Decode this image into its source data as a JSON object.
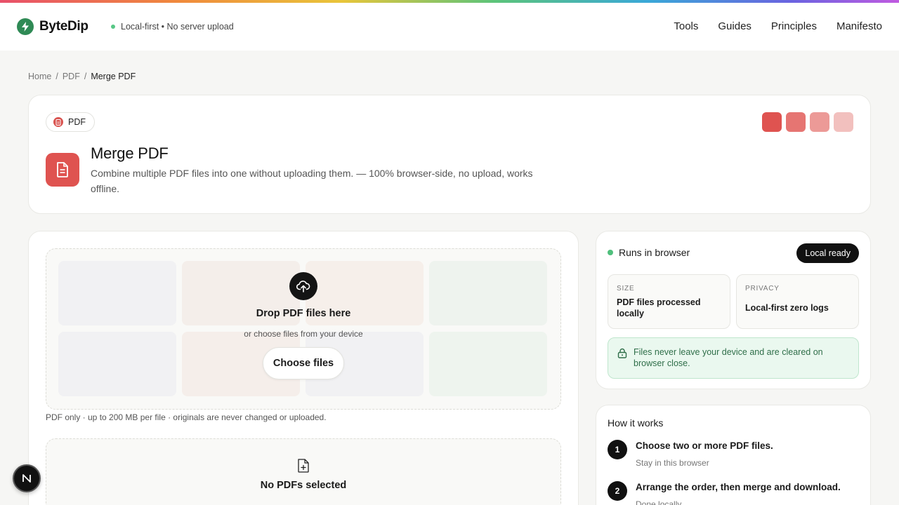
{
  "brand": {
    "name": "ByteDip",
    "tagline": "Local-first • No server upload"
  },
  "nav": [
    {
      "label": "Tools"
    },
    {
      "label": "Guides"
    },
    {
      "label": "Principles"
    },
    {
      "label": "Manifesto"
    }
  ],
  "breadcrumb": [
    {
      "label": "Home"
    },
    {
      "label": "PDF"
    },
    {
      "label": "Merge PDF"
    }
  ],
  "breadcrumb_separator": "/",
  "hero": {
    "chip_label": "PDF",
    "title": "Merge PDF",
    "description": "Combine multiple PDF files into one without uploading them. — 100% browser-side, no upload, works offline.",
    "swatch_colors": [
      "#df5350",
      "#e67572",
      "#ec9a97",
      "#f2c0be"
    ]
  },
  "dropzone": {
    "title": "Drop PDF files here",
    "subtitle": "or choose files from your device",
    "button_label": "Choose files",
    "note": "PDF only · up to 200 MB per file · originals are never changed or uploaded."
  },
  "empty_state": {
    "title": "No PDFs selected"
  },
  "status": {
    "label": "Runs in browser",
    "badge": "Local ready",
    "size_label": "SIZE",
    "size_value": "PDF files processed locally",
    "privacy_label": "PRIVACY",
    "privacy_value": "Local-first zero logs",
    "privacy_note": "Files never leave your device and are cleared on browser close."
  },
  "how_it_works": {
    "title": "How it works",
    "steps": [
      {
        "num": "1",
        "title": "Choose two or more PDF files.",
        "sub": "Stay in this browser"
      },
      {
        "num": "2",
        "title": "Arrange the order, then merge and download.",
        "sub": "Done locally"
      }
    ]
  },
  "fab": {
    "label": "N"
  },
  "colors": {
    "accent": "#df5350",
    "brand_green": "#2f8a55",
    "dark": "#111111"
  }
}
